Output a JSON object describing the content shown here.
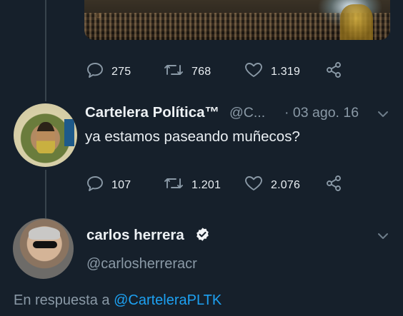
{
  "colors": {
    "background": "#16202b",
    "text": "#e9eef2",
    "muted": "#8a99a6",
    "link": "#1da1f2",
    "thread_line": "#38444d"
  },
  "tweet_top": {
    "media": "photo-image",
    "actions": {
      "replies": "275",
      "retweets": "768",
      "likes": "1.319"
    }
  },
  "tweet_reply": {
    "display_name": "Cartelera Política™",
    "handle_truncated": "@C...",
    "date": "· 03 ago. 16",
    "text": "ya estamos paseando muñecos?",
    "actions": {
      "replies": "107",
      "retweets": "1.201",
      "likes": "2.076"
    }
  },
  "tweet_bottom": {
    "display_name": "carlos herrera",
    "verified_icon": "verified-badge-icon",
    "handle": "@carlosherreracr",
    "reply_to_label": "En respuesta a",
    "reply_to_handle": "@CarteleraPLTK"
  }
}
